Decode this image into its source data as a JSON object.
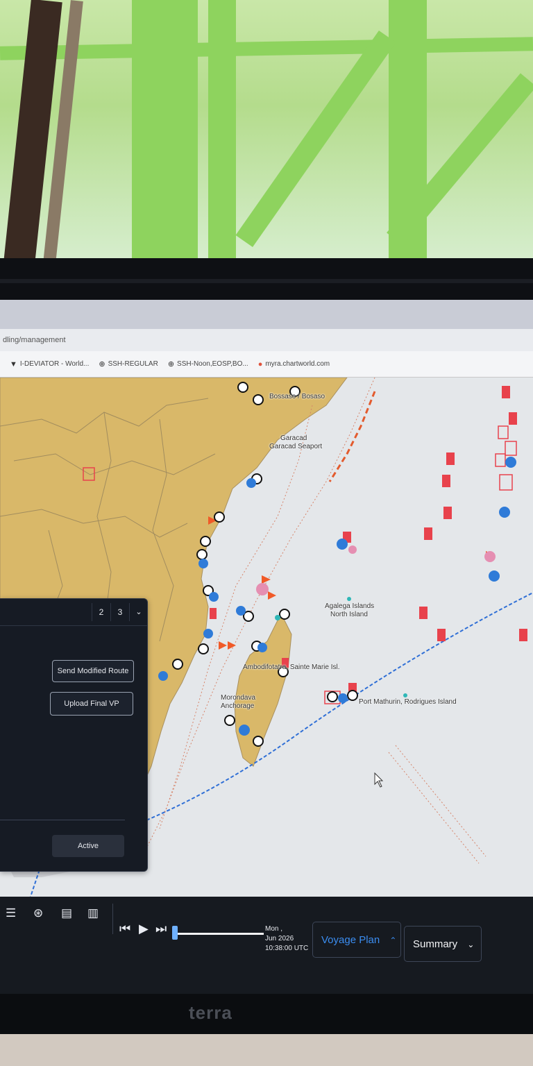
{
  "browser": {
    "url_fragment": "dling/management",
    "bookmarks": [
      {
        "icon": "chevron-down-icon",
        "label": "I-DEVIATOR - World..."
      },
      {
        "icon": "globe-icon",
        "label": "SSH-REGULAR"
      },
      {
        "icon": "globe-icon",
        "label": "SSH-Noon,EOSP,BO..."
      },
      {
        "icon": "map-pin-icon",
        "label": "myra.chartworld.com"
      }
    ]
  },
  "map": {
    "places": [
      "Bossaso / Bosaso",
      "Garacad",
      "Garacad Seaport",
      "Agalega Islands",
      "North Island",
      "Ambodifotatra, Sainte Marie Isl.",
      "Morondava",
      "Anchorage",
      "Port Mathurin, Rodrigues Island"
    ],
    "route_color": "#2f6fd6",
    "land_color": "#d9b869",
    "sea_color": "#e4e7ea",
    "marker_color": "#e8424c"
  },
  "panel": {
    "pages": [
      "2",
      "3"
    ],
    "buttons": {
      "send_modified": "Send Modified Route",
      "upload_final": "Upload Final VP",
      "active": "Active"
    }
  },
  "toolbar": {
    "time": {
      "day": "Mon ,",
      "date": "Jun 2026",
      "clock": "10:38:00 UTC"
    },
    "voyage_plan": "Voyage Plan",
    "summary": "Summary",
    "timeline_progress": 0.0
  },
  "monitor": {
    "brand": "terra"
  }
}
